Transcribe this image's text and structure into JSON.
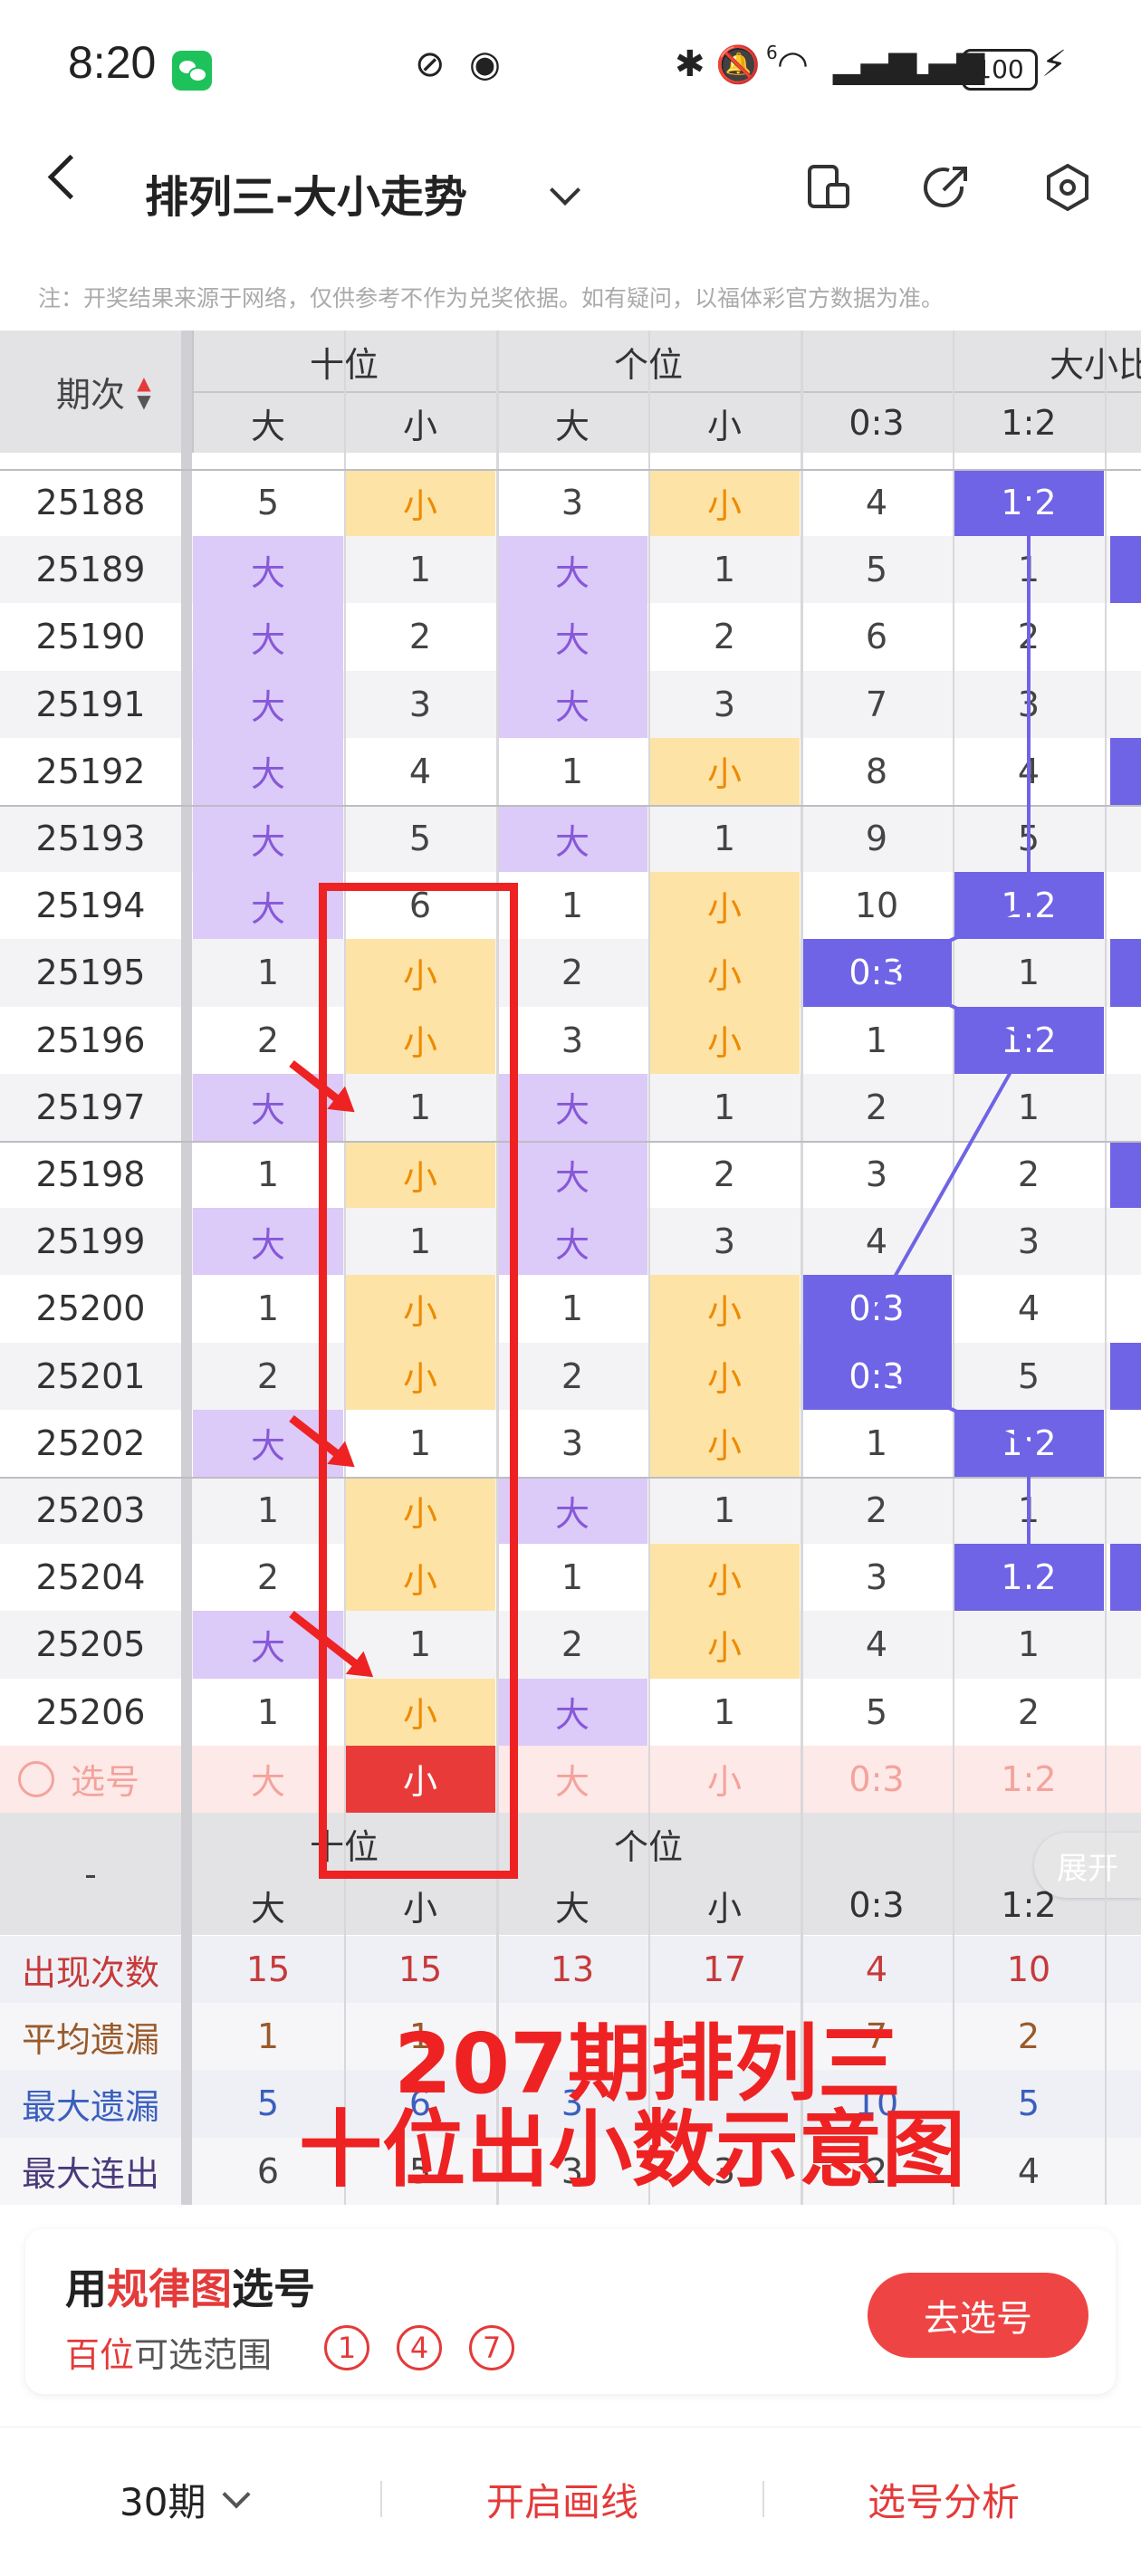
{
  "status": {
    "time": "8:20",
    "battery": "100",
    "sig": "6"
  },
  "nav": {
    "title": "排列三-大小走势"
  },
  "note": "注：开奖结果来源于网络，仅供参考不作为兑奖依据。如有疑问，以福体彩官方数据为准。",
  "table": {
    "period_header": "期次",
    "groups": [
      "十位",
      "个位",
      "大小比"
    ],
    "subheaders": [
      "大",
      "小",
      "大",
      "小",
      "0:3",
      "1:2"
    ],
    "rows": [
      {
        "p": "25188",
        "c": [
          "5",
          "小",
          "3",
          "小",
          "4",
          "1:2"
        ]
      },
      {
        "p": "25189",
        "c": [
          "大",
          "1",
          "大",
          "1",
          "5",
          "1"
        ]
      },
      {
        "p": "25190",
        "c": [
          "大",
          "2",
          "大",
          "2",
          "6",
          "2"
        ]
      },
      {
        "p": "25191",
        "c": [
          "大",
          "3",
          "大",
          "3",
          "7",
          "3"
        ]
      },
      {
        "p": "25192",
        "c": [
          "大",
          "4",
          "1",
          "小",
          "8",
          "4"
        ]
      },
      {
        "p": "25193",
        "c": [
          "大",
          "5",
          "大",
          "1",
          "9",
          "5"
        ]
      },
      {
        "p": "25194",
        "c": [
          "大",
          "6",
          "1",
          "小",
          "10",
          "1:2"
        ]
      },
      {
        "p": "25195",
        "c": [
          "1",
          "小",
          "2",
          "小",
          "0:3",
          "1"
        ]
      },
      {
        "p": "25196",
        "c": [
          "2",
          "小",
          "3",
          "小",
          "1",
          "1:2"
        ]
      },
      {
        "p": "25197",
        "c": [
          "大",
          "1",
          "大",
          "1",
          "2",
          "1"
        ]
      },
      {
        "p": "25198",
        "c": [
          "1",
          "小",
          "大",
          "2",
          "3",
          "2"
        ]
      },
      {
        "p": "25199",
        "c": [
          "大",
          "1",
          "大",
          "3",
          "4",
          "3"
        ]
      },
      {
        "p": "25200",
        "c": [
          "1",
          "小",
          "1",
          "小",
          "0:3",
          "4"
        ]
      },
      {
        "p": "25201",
        "c": [
          "2",
          "小",
          "2",
          "小",
          "0:3",
          "5"
        ]
      },
      {
        "p": "25202",
        "c": [
          "大",
          "1",
          "3",
          "小",
          "1",
          "1:2"
        ]
      },
      {
        "p": "25203",
        "c": [
          "1",
          "小",
          "大",
          "1",
          "2",
          "1"
        ]
      },
      {
        "p": "25204",
        "c": [
          "2",
          "小",
          "1",
          "小",
          "3",
          "1:2"
        ]
      },
      {
        "p": "25205",
        "c": [
          "大",
          "1",
          "2",
          "小",
          "4",
          "1"
        ]
      },
      {
        "p": "25206",
        "c": [
          "1",
          "小",
          "大",
          "1",
          "5",
          "2"
        ]
      }
    ],
    "select_row": {
      "label": "选号",
      "c": [
        "大",
        "小",
        "大",
        "小",
        "0:3",
        "1:2"
      ]
    },
    "footer_dash": "-",
    "stats": [
      {
        "label": "出现次数",
        "c": [
          "15",
          "15",
          "13",
          "17",
          "4",
          "10"
        ]
      },
      {
        "label": "平均遗漏",
        "c": [
          "1",
          "1",
          "",
          "",
          "7",
          "2"
        ]
      },
      {
        "label": "最大遗漏",
        "c": [
          "5",
          "6",
          "3",
          "",
          "10",
          "5"
        ]
      },
      {
        "label": "最大连出",
        "c": [
          "6",
          "5",
          "3",
          "3",
          "2",
          "4"
        ]
      }
    ],
    "expand_label": "展开"
  },
  "overlay": {
    "line1": "207期排列三",
    "line2": "十位出小数示意图"
  },
  "card": {
    "title_a": "用",
    "title_b": "规律图",
    "title_c": "选号",
    "sub_a": "百位",
    "sub_b": "可选范围",
    "nums": [
      "1",
      "4",
      "7"
    ],
    "button": "去选号"
  },
  "bottombar": {
    "periods": "30期",
    "draw": "开启画线",
    "analysis": "选号分析"
  },
  "colors": {
    "big": "#dccaf8",
    "small": "#fde3a6",
    "ratio": "#6f63e6",
    "red": "#ee2222"
  }
}
